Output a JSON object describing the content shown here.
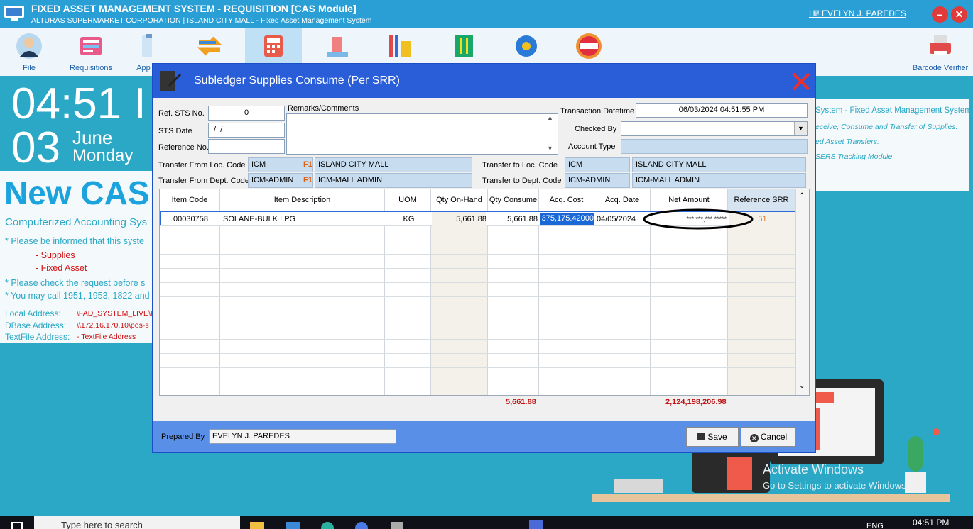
{
  "window": {
    "title": "FIXED ASSET MANAGEMENT SYSTEM - REQUISITION [CAS Module]",
    "subtitle": "ALTURAS SUPERMARKET CORPORATION | ISLAND CITY MALL - Fixed Asset Management System",
    "user": "Hi! EVELYN J. PAREDES",
    "minimize": "–",
    "close": "✕"
  },
  "toolbar": {
    "file": "File",
    "requisitions": "Requisitions",
    "app": "App",
    "barcode": "Barcode Verifier"
  },
  "clock": {
    "time": "04:51 I",
    "day": "03",
    "month": "June",
    "weekday": "Monday"
  },
  "info": {
    "banner": "New CAS",
    "subtitle": "Computerized Accounting Sys",
    "line1": "* Please be informed that this syste",
    "item1": "- Supplies",
    "item2": "- Fixed Asset",
    "line2": "* Please check the request before s",
    "line3": "* You may call 1951, 1953, 1822 and",
    "local_label": "Local Address:",
    "local_value": "\\FAD_SYSTEM_LIVE\\FA",
    "dbase_label": "DBase Address:",
    "dbase_value": "\\\\172.16.170.10\\pos-s",
    "text_label": "TextFile Address:",
    "text_value": "- TextFile Address"
  },
  "right_panel": {
    "l1": "System - Fixed Asset Management System",
    "l2": "eceive, Consume and Transfer of Supplies.",
    "l3": "ed Asset Transfers.",
    "l4": "SERS Tracking Module"
  },
  "watermark": {
    "l1": "Activate Windows",
    "l2": "Go to Settings to activate Windows."
  },
  "modal": {
    "title": "Subledger Supplies Consume (Per SRR)",
    "ref_sts_label": "Ref. STS No.",
    "ref_sts_value": "0",
    "sts_date_label": "STS Date",
    "sts_date_value": " /  /",
    "reference_label": "Reference No.",
    "reference_value": "",
    "remarks_label": "Remarks/Comments",
    "transaction_label": "Transaction Datetime",
    "transaction_value": "06/03/2024 04:51:55 PM",
    "checked_label": "Checked By",
    "checked_value": "",
    "account_label": "Account Type",
    "account_value": "",
    "from_loc_label": "Transfer From Loc. Code",
    "from_loc_code": "ICM",
    "from_loc_name": "ISLAND CITY MALL",
    "from_dept_label": "Transfer From Dept. Code",
    "from_dept_code": "ICM-ADMIN",
    "from_dept_name": "ICM-MALL ADMIN",
    "to_loc_label": "Transfer to Loc. Code",
    "to_loc_code": "ICM",
    "to_loc_name": "ISLAND CITY MALL",
    "to_dept_label": "Transfer to Dept. Code",
    "to_dept_code": "ICM-ADMIN",
    "to_dept_name": "ICM-MALL ADMIN",
    "f1": "F1",
    "columns": [
      "Item Code",
      "Item Description",
      "UOM",
      "Qty On-Hand",
      "Qty Consume",
      "Acq. Cost",
      "Acq. Date",
      "Net Amount",
      "Reference SRR"
    ],
    "row": {
      "item_code": "00030758",
      "description": "SOLANE-BULK LPG",
      "uom": "KG",
      "qty_on_hand": "5,661.88",
      "qty_consume": "5,661.88",
      "acq_cost": "375,175.42000",
      "acq_date": "04/05/2024",
      "net_amount": "***,***,***.*****",
      "ref_srr": "51"
    },
    "total_qty": "5,661.88",
    "total_amount": "2,124,198,206.98",
    "prepared_label": "Prepared By",
    "prepared_value": "EVELYN J. PAREDES",
    "save_label": "Save",
    "cancel_label": "Cancel"
  },
  "taskbar": {
    "search": "Type here to search",
    "lang": "ENG",
    "time": "04:51 PM"
  }
}
